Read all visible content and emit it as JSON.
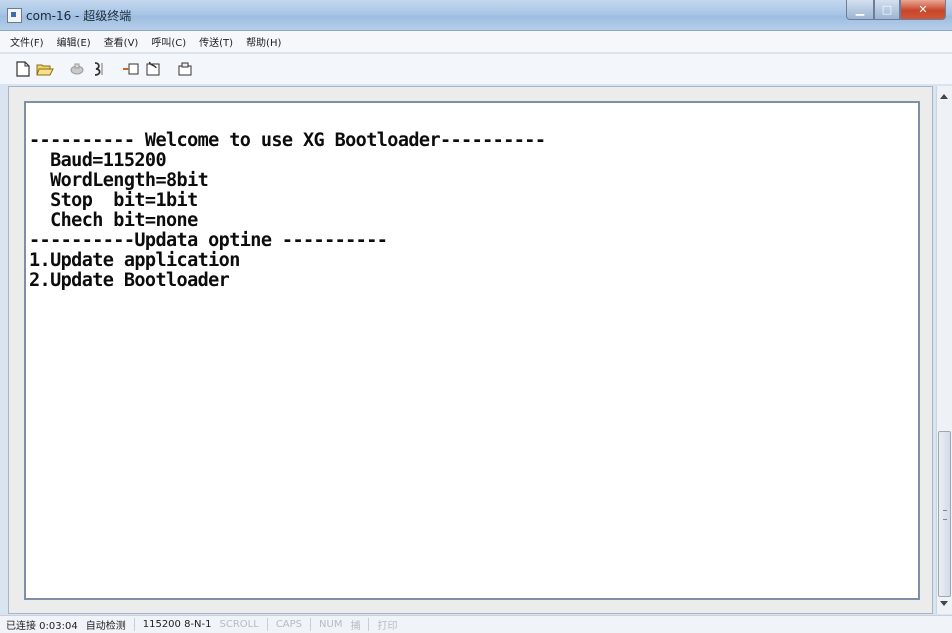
{
  "window": {
    "title": "com-16 - 超级终端",
    "buttons": {
      "minimize": "▁",
      "maximize": "□",
      "close": "✕"
    }
  },
  "menu": [
    "文件(F)",
    "编辑(E)",
    "查看(V)",
    "呼叫(C)",
    "传送(T)",
    "帮助(H)"
  ],
  "toolbar": [
    "new-icon",
    "open-icon",
    "disconnect-icon",
    "properties-icon",
    "send-icon",
    "receive-icon",
    "settings-icon"
  ],
  "terminal": {
    "lines": [
      "---------- Welcome to use XG Bootloader----------",
      "  Baud=115200",
      "  WordLength=8bit",
      "  Stop  bit=1bit",
      "  Chech bit=none",
      "----------Updata optine ----------",
      "1.Update application",
      "2.Update Bootloader"
    ]
  },
  "status": {
    "connected": "已连接 0:03:04",
    "detect": "自动检测",
    "settings": "115200 8-N-1",
    "scroll": "SCROLL",
    "caps": "CAPS",
    "num": "NUM",
    "capture": "捕",
    "print": "打印"
  }
}
